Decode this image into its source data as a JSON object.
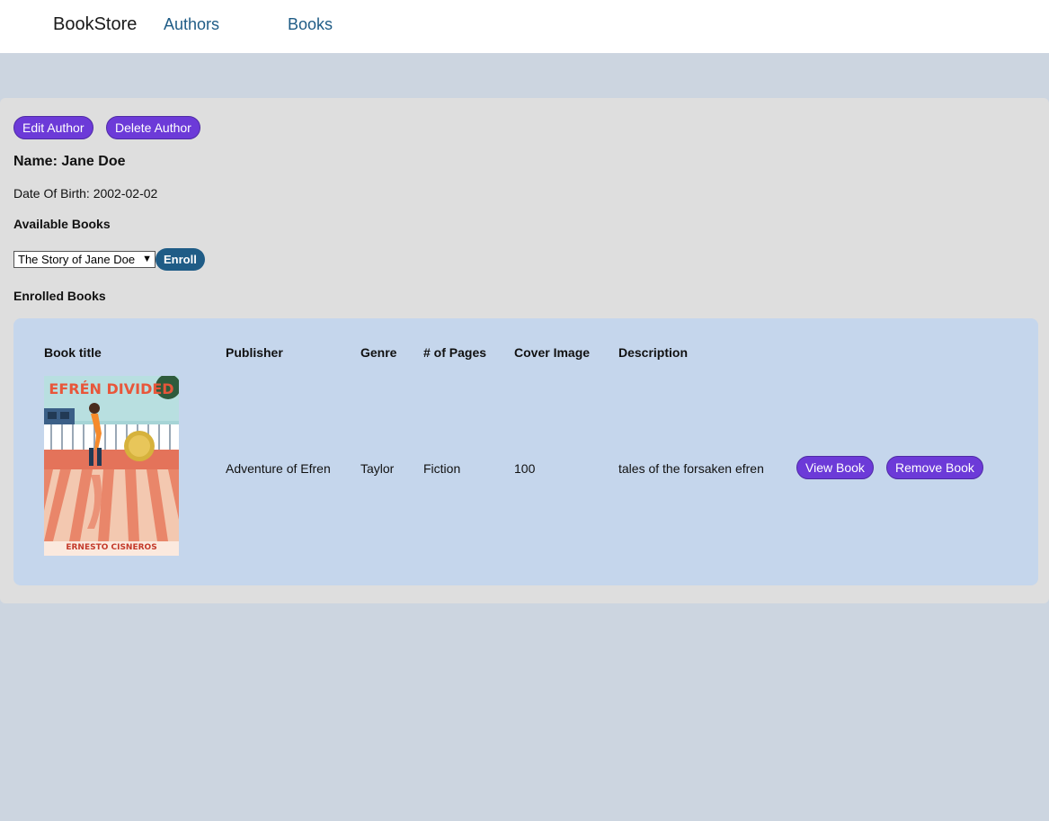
{
  "nav": {
    "brand": "BookStore",
    "authors": "Authors",
    "books": "Books"
  },
  "author": {
    "edit_label": "Edit Author",
    "delete_label": "Delete Author",
    "name": "Name: Jane Doe",
    "dob": "Date Of Birth: 2002-02-02"
  },
  "available": {
    "heading": "Available Books",
    "selected": "The Story of Jane Doe",
    "enroll_label": "Enroll"
  },
  "enrolled": {
    "heading": "Enrolled Books",
    "columns": [
      "Book title",
      "Publisher",
      "Genre",
      "# of Pages",
      "Cover Image",
      "Description"
    ],
    "rows": [
      {
        "cover_title": "EFRÉN DIVIDED",
        "cover_author": "ERNESTO CISNEROS",
        "title": "Adventure of Efren",
        "publisher": "Taylor",
        "genre": "Fiction",
        "pages": "100",
        "description": "tales of the forsaken efren",
        "view_label": "View Book",
        "remove_label": "Remove Book"
      }
    ]
  },
  "colors": {
    "accent_purple": "#6c3ad8",
    "accent_blue": "#1f5c86",
    "page_bg": "#ccd5e0",
    "panel_bg": "#c5d6ec"
  }
}
